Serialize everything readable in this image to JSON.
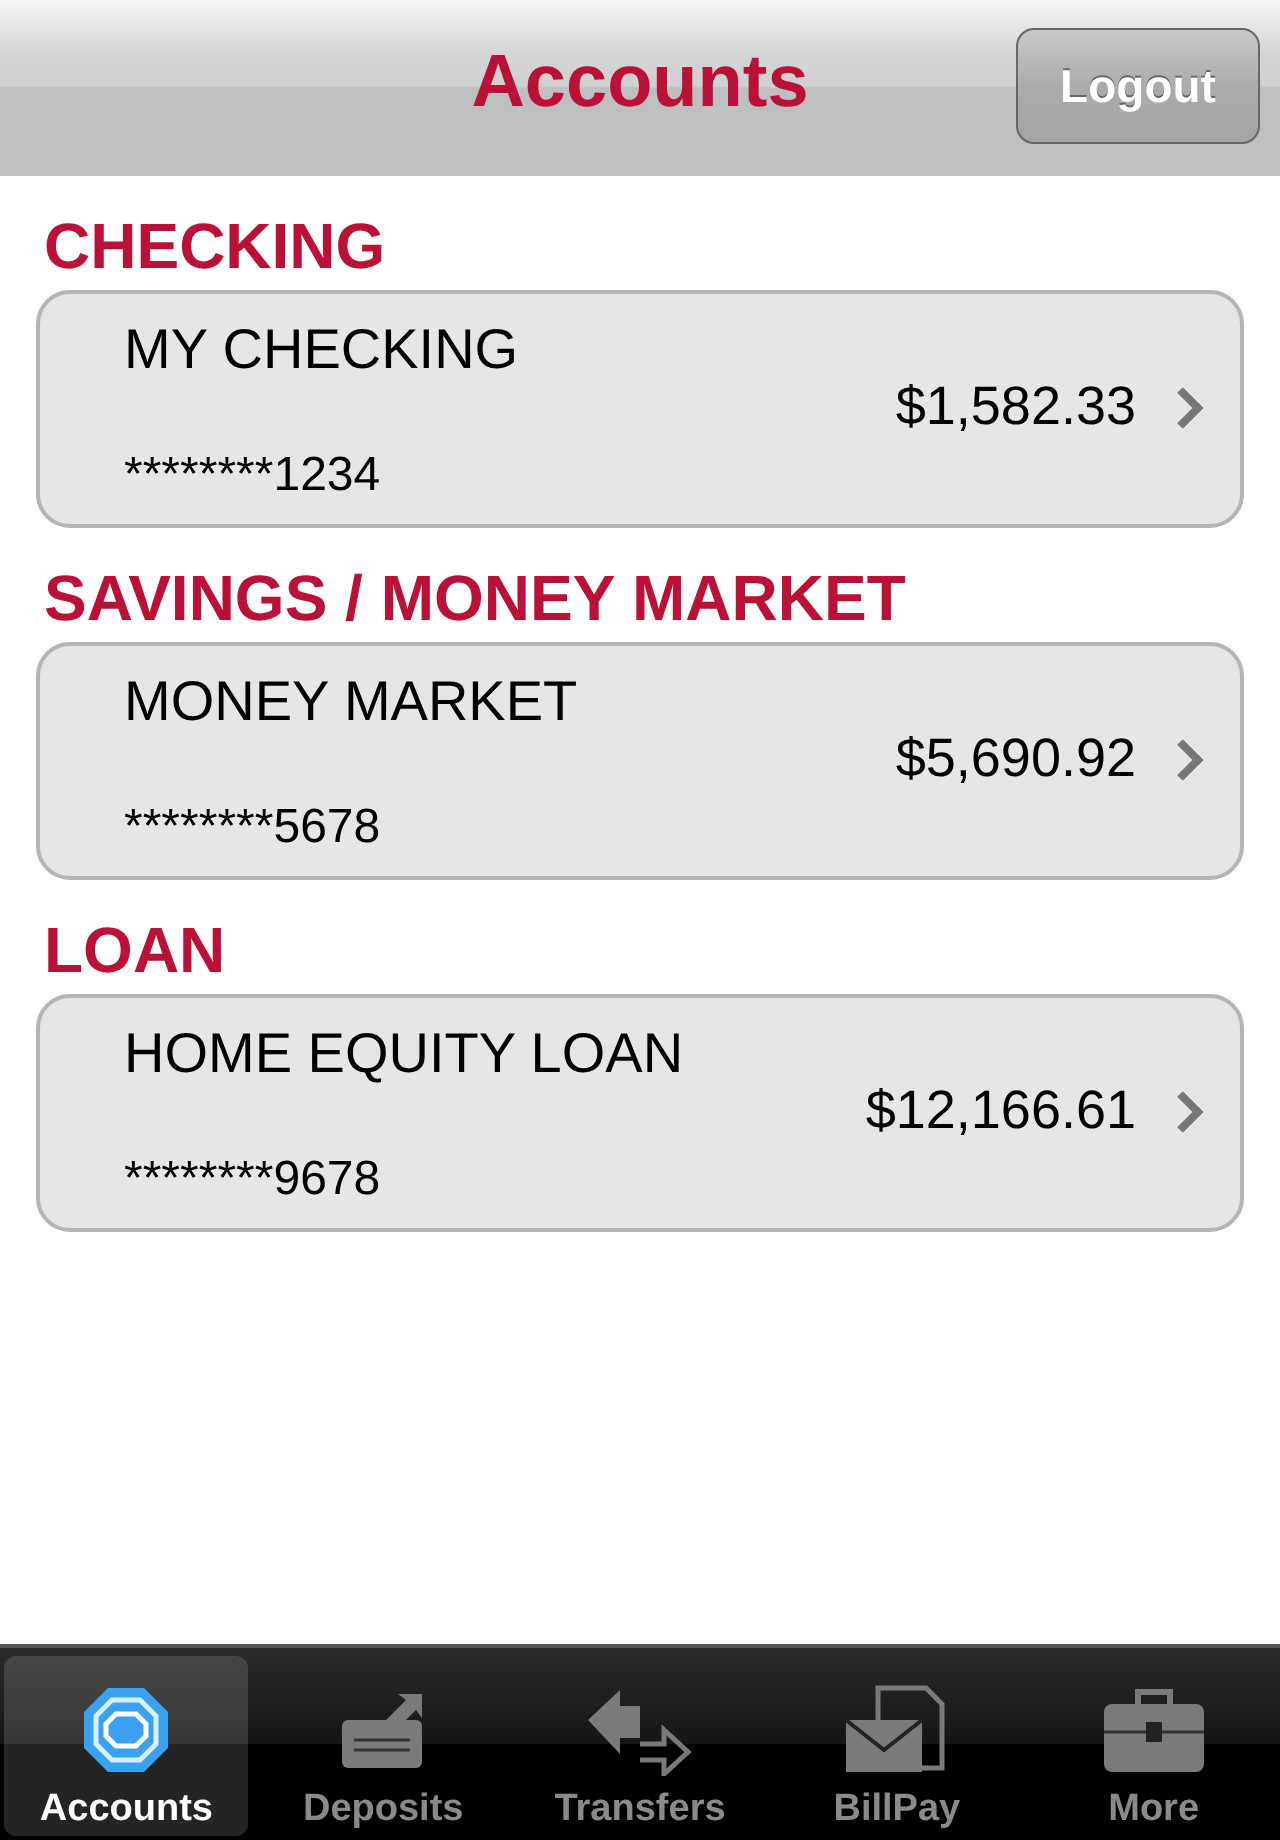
{
  "header": {
    "title": "Accounts",
    "logout_button": "Logout"
  },
  "sections": [
    {
      "heading": "CHECKING",
      "accounts": [
        {
          "name": "MY CHECKING",
          "number": "********1234",
          "balance": "$1,582.33"
        }
      ]
    },
    {
      "heading": "SAVINGS / MONEY MARKET",
      "accounts": [
        {
          "name": "MONEY MARKET",
          "number": "********5678",
          "balance": "$5,690.92"
        }
      ]
    },
    {
      "heading": "LOAN",
      "accounts": [
        {
          "name": "HOME EQUITY LOAN",
          "number": "********9678",
          "balance": "$12,166.61"
        }
      ]
    }
  ],
  "tab_bar": [
    {
      "label": "Accounts",
      "kind": "accounts",
      "selected": true
    },
    {
      "label": "Deposits",
      "kind": "deposits",
      "selected": false
    },
    {
      "label": "Transfers",
      "kind": "transfers",
      "selected": false
    },
    {
      "label": "BillPay",
      "kind": "billpay",
      "selected": false
    },
    {
      "label": "More",
      "kind": "more",
      "selected": false
    }
  ]
}
